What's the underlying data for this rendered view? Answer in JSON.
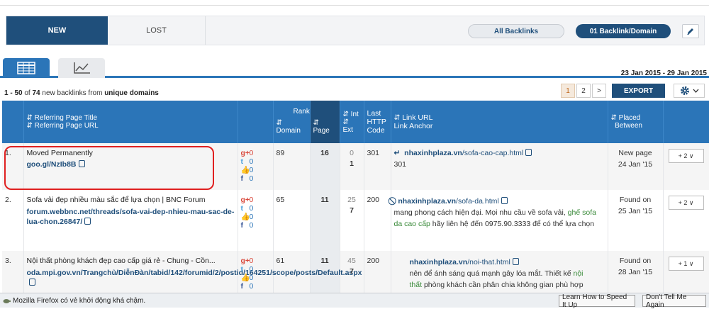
{
  "toggle": {
    "new": "NEW",
    "lost": "LOST"
  },
  "pills": {
    "all": "All Backlinks",
    "one_per_domain": "01 Backlink/Domain"
  },
  "icons": {
    "edit": "pencil-icon",
    "table_view": "table-icon",
    "chart_view": "line-chart-icon",
    "settings": "gear-icon"
  },
  "date_range": "23 Jan 2015 - 29 Jan 2015",
  "summary": {
    "range": "1 - 50",
    "of": "of",
    "total": "74",
    "mid": "new backlinks from",
    "scope": "unique domains"
  },
  "pager": {
    "pages": [
      "1",
      "2",
      ">"
    ],
    "active": "1"
  },
  "export_label": "EXPORT",
  "headers": {
    "ref_title": "Referring Page Title",
    "ref_url": "Referring Page URL",
    "rank": "Rank",
    "domain": "Domain",
    "page": "Page",
    "int": "Int",
    "ext": "Ext",
    "last": "Last",
    "http": "HTTP",
    "code": "Code",
    "link_url": "Link URL",
    "link_anchor": "Link Anchor",
    "placed": "Placed",
    "between": "Between"
  },
  "rows": [
    {
      "index": "1.",
      "title": "Moved Permanently",
      "url": "goo.gl/NzIb8B",
      "social": [
        "0",
        "0",
        "0",
        "0"
      ],
      "domain_rank": "89",
      "page_rank": "16",
      "int": "0",
      "ext": "1",
      "http": "301",
      "link_domain": "nhaxinhplaza.vn",
      "link_path": "/sofa-cao-cap.html",
      "anchor": "301",
      "placed_label": "New page",
      "placed_date": "24 Jan '15",
      "plus": "+ 2"
    },
    {
      "index": "2.",
      "title": "Sofa vải đẹp nhiều màu sắc để lựa chọn | BNC Forum",
      "url": "forum.webbnc.net/threads/sofa-vai-dep-nhieu-mau-sac-de-lua-chon.26847/",
      "social": [
        "0",
        "0",
        "0",
        "0"
      ],
      "domain_rank": "65",
      "page_rank": "11",
      "int": "25",
      "ext": "7",
      "http": "200",
      "link_domain": "nhaxinhplaza.vn",
      "link_path": "/sofa-da.html",
      "anchor_pre": "mang phong cách hiện đại. Mọi nhu cầu về sofa vải,",
      "anchor_green": "ghế sofa da cao cấp",
      "anchor_post": "hãy liên hệ đến 0975.90.3333 để có thể lựa chọn",
      "placed_label": "Found on",
      "placed_date": "25 Jan '15",
      "plus": "+ 2"
    },
    {
      "index": "3.",
      "title": "Nội thất phòng khách đẹp cao cấp giá rẻ - Chung - Cồn...",
      "url": "oda.mpi.gov.vn/Trangchủ/DiễnĐàn/tabid/142/forumid/2/postid/164251/scope/posts/Default.aspx",
      "social": [
        "0",
        "0",
        "0",
        "0"
      ],
      "domain_rank": "61",
      "page_rank": "11",
      "int": "45",
      "ext": "7",
      "http": "200",
      "link_domain": "nhaxinhplaza.vn",
      "link_path": "/noi-that.html",
      "anchor_pre": "nên để ánh sáng quá mạnh gây lóa mắt. Thiết kế",
      "anchor_green1": "nội",
      "anchor_green2": "thất",
      "anchor_post": "phòng khách cần phân chia không gian phù hợp",
      "placed_label": "Found on",
      "placed_date": "28 Jan '15",
      "plus": "+ 1"
    }
  ],
  "statusbar": {
    "message": "Mozilla Firefox có vẻ khởi động khá chậm.",
    "speed_btn": "Learn How to Speed It Up",
    "dismiss_btn": "Don't Tell Me Again"
  }
}
